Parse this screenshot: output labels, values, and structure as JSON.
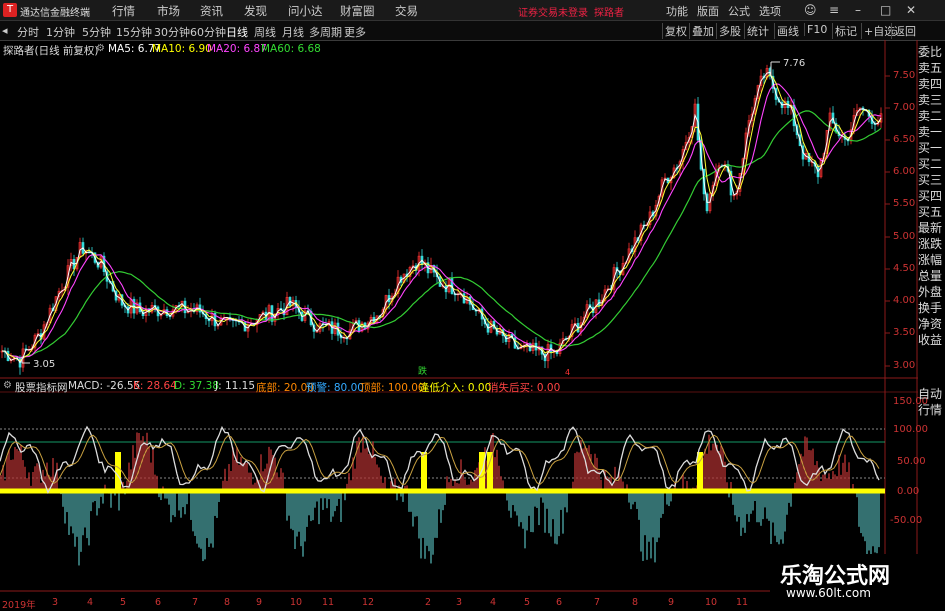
{
  "titlebar": {
    "app_title": "通达信金融终端",
    "menu": [
      "行情",
      "市场",
      "资讯",
      "发现",
      "问小达",
      "财富圈",
      "交易"
    ],
    "login_status": "证券交易未登录",
    "stock_name": "探路者",
    "right": [
      "功能",
      "版面",
      "公式",
      "选项"
    ]
  },
  "toolbar": {
    "periods": [
      "分时",
      "1分钟",
      "5分钟",
      "15分钟",
      "30分钟",
      "60分钟",
      "日线",
      "周线",
      "月线",
      "多周期",
      "更多"
    ],
    "active": "日线",
    "right": [
      "复权",
      "叠加",
      "多股",
      "统计",
      "画线",
      "F10",
      "标记",
      "+自选",
      "返回"
    ]
  },
  "main_chart": {
    "title": "探路者(日线 前复权)",
    "ma": [
      {
        "label": "MA5: 6.77",
        "color": "#ffffff"
      },
      {
        "label": "MA10: 6.90",
        "color": "#ffff00"
      },
      {
        "label": "MA20: 6.87",
        "color": "#ff44ff"
      },
      {
        "label": "MA60: 6.68",
        "color": "#33dd33"
      }
    ],
    "high_label": "7.76",
    "low_label": "3.05",
    "axis": [
      "7.50",
      "7.00",
      "6.50",
      "6.00",
      "5.50",
      "5.00",
      "4.50",
      "4.00",
      "3.50",
      "3.00"
    ],
    "signal_up": "跌",
    "signal_down": "4"
  },
  "sub_chart": {
    "title": "股票指标网",
    "values": [
      {
        "label": "MACD: -26.55",
        "color": "#dddddd"
      },
      {
        "label": "K: 28.64",
        "color": "#ff4444"
      },
      {
        "label": "D: 37.38",
        "color": "#33dd33"
      },
      {
        "label": "J: 11.15",
        "color": "#dddddd"
      },
      {
        "label": "底部: 20.00",
        "color": "#ff8800"
      },
      {
        "label": "预警: 80.00",
        "color": "#33aaff"
      },
      {
        "label": "顶部: 100.00",
        "color": "#ff8800"
      },
      {
        "label": "逢低介入: 0.00",
        "color": "#ffff00"
      },
      {
        "label": "消失后买: 0.00",
        "color": "#ff4444"
      }
    ],
    "axis": [
      "150.00",
      "100.00",
      "50.00",
      "0.00",
      "-50.00"
    ]
  },
  "side_panel": [
    "委比",
    "卖五",
    "卖四",
    "卖三",
    "卖二",
    "卖一",
    "买一",
    "买二",
    "买三",
    "买四",
    "买五",
    "最新",
    "涨跌",
    "涨幅",
    "总量",
    "外盘",
    "换手",
    "净资",
    "收益"
  ],
  "side_tabs": [
    "自动",
    "行情"
  ],
  "months": [
    "2019年",
    "3",
    "4",
    "5",
    "6",
    "7",
    "8",
    "9",
    "10",
    "11",
    "12",
    "2",
    "3",
    "4",
    "5",
    "6",
    "7",
    "8",
    "9",
    "10",
    "11"
  ],
  "watermark": {
    "name": "乐淘公式网",
    "url": "www.60lt.com"
  }
}
